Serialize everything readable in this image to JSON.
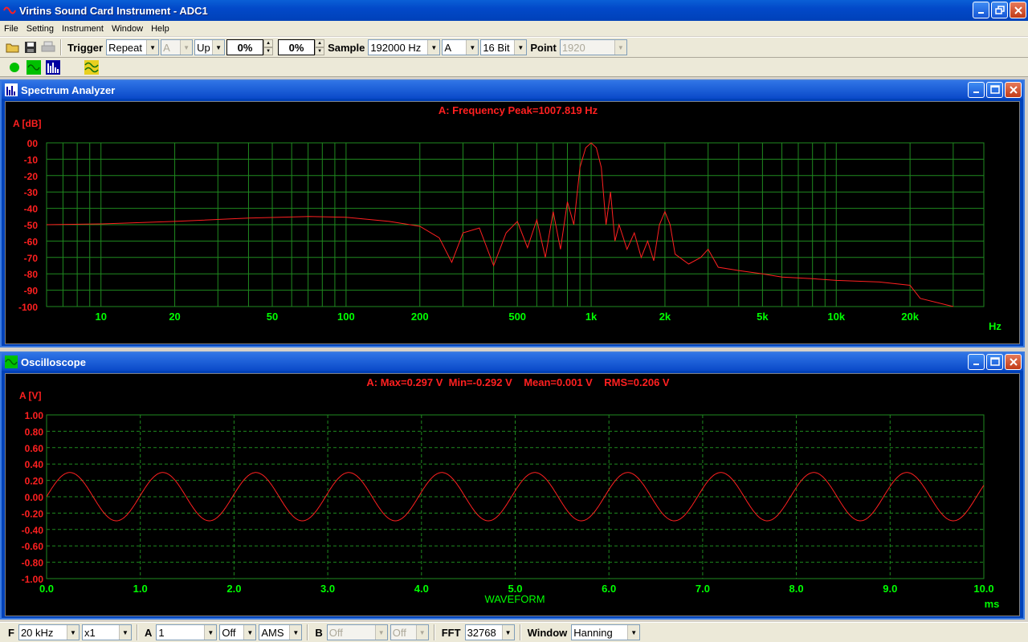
{
  "window": {
    "title": "Virtins Sound Card Instrument - ADC1"
  },
  "menu": [
    "File",
    "Setting",
    "Instrument",
    "Window",
    "Help"
  ],
  "toolbar": {
    "trigger_label": "Trigger",
    "trigger_mode": "Repeat",
    "trigger_channel": "A",
    "trigger_edge": "Up",
    "trigger_level": "0%",
    "trigger_delay": "0%",
    "sample_label": "Sample",
    "sample_rate": "192000 Hz",
    "channel": "A",
    "bits": "16 Bit",
    "point_label": "Point",
    "points": "1920"
  },
  "spectrum": {
    "title": "Spectrum Analyzer",
    "header": "A: Frequency Peak=1007.819 Hz",
    "ylabel": "A [dB]",
    "xunit": "Hz"
  },
  "scope": {
    "title": "Oscilloscope",
    "header": "A: Max=0.297 V  Min=-0.292 V    Mean=0.001 V    RMS=0.206 V",
    "ylabel": "A [V]",
    "xunit": "ms",
    "xlabel": "WAVEFORM"
  },
  "statusbar": {
    "f_label": "F",
    "f_value": "20 kHz",
    "zoom": "x1",
    "a_label": "A",
    "a_value": "1",
    "a_off": "Off",
    "a_mode": "AMS",
    "b_label": "B",
    "b_value": "Off",
    "b_off": "Off",
    "fft_label": "FFT",
    "fft_value": "32768",
    "window_label": "Window",
    "window_value": "Hanning"
  },
  "colors": {
    "grid": "#1f8a1f",
    "axis_text": "#00ff00",
    "trace": "#ff2020",
    "header_text": "#ff2020"
  },
  "chart_data": [
    {
      "type": "line",
      "name": "Spectrum Analyzer",
      "title": "A: Frequency Peak=1007.819 Hz",
      "ylabel": "A [dB]",
      "xlabel": "Hz",
      "xscale": "log",
      "xlim": [
        6,
        40000
      ],
      "ylim": [
        -100,
        0
      ],
      "y_ticks": [
        "00",
        "-10",
        "-20",
        "-30",
        "-40",
        "-50",
        "-60",
        "-70",
        "-80",
        "-90",
        "-100"
      ],
      "x_ticks": [
        {
          "value": 10,
          "label": "10"
        },
        {
          "value": 20,
          "label": "20"
        },
        {
          "value": 50,
          "label": "50"
        },
        {
          "value": 100,
          "label": "100"
        },
        {
          "value": 200,
          "label": "200"
        },
        {
          "value": 500,
          "label": "500"
        },
        {
          "value": 1000,
          "label": "1k"
        },
        {
          "value": 2000,
          "label": "2k"
        },
        {
          "value": 5000,
          "label": "5k"
        },
        {
          "value": 10000,
          "label": "10k"
        },
        {
          "value": 20000,
          "label": "20k"
        }
      ],
      "series": [
        {
          "x": [
            6,
            10,
            20,
            40,
            70,
            100,
            150,
            200,
            240,
            270,
            300,
            350,
            400,
            450,
            500,
            550,
            600,
            650,
            700,
            750,
            800,
            850,
            900,
            950,
            1000,
            1050,
            1100,
            1150,
            1200,
            1250,
            1300,
            1400,
            1500,
            1600,
            1700,
            1800,
            1900,
            2000,
            2100,
            2200,
            2500,
            2800,
            3000,
            3300,
            4000,
            5000,
            6000,
            8000,
            10000,
            15000,
            20000,
            22000,
            30000
          ],
          "values": [
            -50,
            -49.5,
            -48,
            -46,
            -45,
            -45.5,
            -48,
            -51,
            -58,
            -73,
            -55,
            -52,
            -75,
            -55,
            -48,
            -64,
            -47,
            -70,
            -42,
            -65,
            -36,
            -50,
            -15,
            -3,
            0,
            -3,
            -15,
            -50,
            -30,
            -60,
            -50,
            -65,
            -55,
            -70,
            -60,
            -72,
            -50,
            -42,
            -50,
            -68,
            -74,
            -70,
            -65,
            -76,
            -78,
            -80,
            -82,
            -83,
            -84,
            -85,
            -87,
            -95,
            -100
          ]
        }
      ]
    },
    {
      "type": "line",
      "name": "Oscilloscope",
      "title": "A: Max=0.297 V  Min=-0.292 V    Mean=0.001 V    RMS=0.206 V",
      "ylabel": "A [V]",
      "xlabel": "WAVEFORM",
      "xunit": "ms",
      "xlim": [
        0,
        10
      ],
      "ylim": [
        -1,
        1
      ],
      "y_ticks": [
        "1.00",
        "0.80",
        "0.60",
        "0.40",
        "0.20",
        "0.00",
        "-0.20",
        "-0.40",
        "-0.60",
        "-0.80",
        "-1.00"
      ],
      "x_ticks": [
        "0.0",
        "1.0",
        "2.0",
        "3.0",
        "4.0",
        "5.0",
        "6.0",
        "7.0",
        "8.0",
        "9.0",
        "10.0"
      ],
      "series": [
        {
          "function": "sine",
          "amplitude_v": 0.295,
          "frequency_hz": 1007.819,
          "offset_v": 0.001,
          "phase_deg": 0
        }
      ]
    }
  ]
}
